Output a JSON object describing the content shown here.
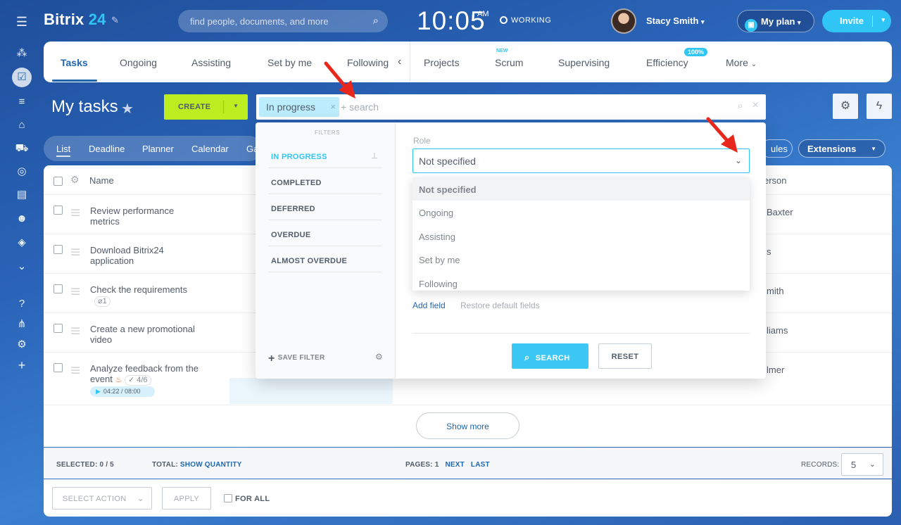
{
  "header": {
    "logo_text": "Bitrix",
    "logo_num": "24",
    "search_placeholder": "find people, documents, and more",
    "time": "10:05",
    "ampm": "AM",
    "status": "WORKING",
    "user_name": "Stacy Smith",
    "plan_label": "My plan",
    "invite_label": "Invite"
  },
  "tabs": [
    {
      "label": "Tasks"
    },
    {
      "label": "Ongoing"
    },
    {
      "label": "Assisting"
    },
    {
      "label": "Set by me"
    },
    {
      "label": "Following"
    },
    {
      "label": "Projects"
    },
    {
      "label": "Scrum"
    },
    {
      "label": "Supervising"
    },
    {
      "label": "Efficiency"
    },
    {
      "label": "More"
    }
  ],
  "tab_badges": {
    "scrum": "NEW",
    "efficiency": "100%"
  },
  "toolbar": {
    "page_title": "My tasks",
    "create_label": "CREATE",
    "filter_chip": "In progress",
    "filter_placeholder": "+ search"
  },
  "views": [
    "List",
    "Deadline",
    "Planner",
    "Calendar",
    "Ga"
  ],
  "right_buttons": {
    "rules": "ules",
    "extensions": "Extensions"
  },
  "grid": {
    "col_name": "Name",
    "col_person": "erson",
    "rows": [
      {
        "name": "Review performance metrics",
        "person": "Baxter"
      },
      {
        "name": "Download Bitrix24 application",
        "person": "s"
      },
      {
        "name": "Check the requirements",
        "tag": "1",
        "person": "mith"
      },
      {
        "name": "Create a new promotional video",
        "person": "liams"
      },
      {
        "name": "Analyze feedback from the event",
        "tag": "4/6",
        "timer": "04:22 / 08:00",
        "person": "lmer"
      }
    ],
    "show_more": "Show more"
  },
  "footer": {
    "selected_label": "SELECTED:",
    "selected_value": "0 / 5",
    "total_label": "TOTAL:",
    "total_value": "SHOW QUANTITY",
    "pages_label": "PAGES:",
    "page_num": "1",
    "next": "NEXT",
    "last": "LAST",
    "records_label": "RECORDS:",
    "records_value": "5"
  },
  "actions": {
    "select_action": "SELECT ACTION",
    "apply": "APPLY",
    "for_all": "FOR ALL"
  },
  "filter_popup": {
    "filters_label": "FILTERS",
    "presets": [
      "IN PROGRESS",
      "COMPLETED",
      "DEFERRED",
      "OVERDUE",
      "ALMOST OVERDUE"
    ],
    "save_filter": "SAVE FILTER",
    "role_label": "Role",
    "role_value": "Not specified",
    "role_options": [
      "Not specified",
      "Ongoing",
      "Assisting",
      "Set by me",
      "Following"
    ],
    "add_field": "Add field",
    "restore": "Restore default fields",
    "search_btn": "SEARCH",
    "reset_btn": "RESET"
  },
  "colors": {
    "accent": "#2fc6f6",
    "create_green": "#bbed21",
    "link_blue": "#2067b0",
    "annotation_red": "#e8281d"
  }
}
